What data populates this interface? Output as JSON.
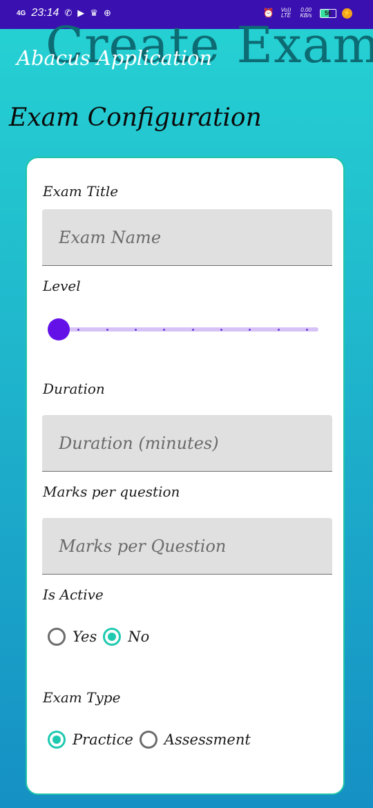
{
  "status_bar": {
    "network": "4G",
    "time": "23:14",
    "carrier": "Vo)) LTE",
    "speed": "0.00 KB/s",
    "battery": "56",
    "icons": [
      "signal-icon",
      "whatsapp-icon",
      "youtube-icon",
      "trophy-icon",
      "hotspot-icon",
      "alarm-icon",
      "charging-icon"
    ]
  },
  "header": {
    "background_title": "Create Exam",
    "app_title": "Abacus Application"
  },
  "page_heading": "Exam Configuration",
  "form": {
    "exam_title": {
      "label": "Exam Title",
      "placeholder": "Exam Name",
      "value": ""
    },
    "level": {
      "label": "Level",
      "value": 0,
      "max": 9
    },
    "duration": {
      "label": "Duration",
      "placeholder": "Duration (minutes)",
      "value": ""
    },
    "marks": {
      "label": "Marks per question",
      "placeholder": "Marks per Question",
      "value": ""
    },
    "is_active": {
      "label": "Is Active",
      "options": [
        "Yes",
        "No"
      ],
      "selected": "No"
    },
    "exam_type": {
      "label": "Exam Type",
      "options": [
        "Practice",
        "Assessment"
      ],
      "selected": "Practice"
    }
  },
  "colors": {
    "accent": "#1ec9b0",
    "slider_thumb": "#6411e8",
    "status_bar": "#3a10b0",
    "bg_top": "#26d3d3",
    "bg_bottom": "#1590c4"
  }
}
